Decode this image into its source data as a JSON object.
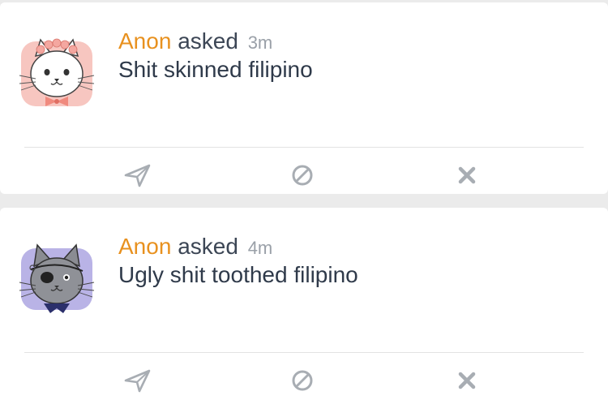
{
  "questions": [
    {
      "author": "Anon",
      "verb": "asked",
      "time": "3m",
      "text": "Shit skinned filipino",
      "avatar_icon": "white-cat-flower-crown-avatar",
      "actions": [
        "send-icon",
        "block-icon",
        "delete-icon"
      ]
    },
    {
      "author": "Anon",
      "verb": "asked",
      "time": "4m",
      "text": "Ugly shit toothed filipino",
      "avatar_icon": "gray-pirate-cat-avatar",
      "actions": [
        "send-icon",
        "block-icon",
        "delete-icon"
      ]
    }
  ],
  "colors": {
    "author": "#e8911f",
    "text": "#2f3a4a",
    "time": "#9aa0a8",
    "icon": "#a8adb3",
    "background": "#ebebeb"
  }
}
